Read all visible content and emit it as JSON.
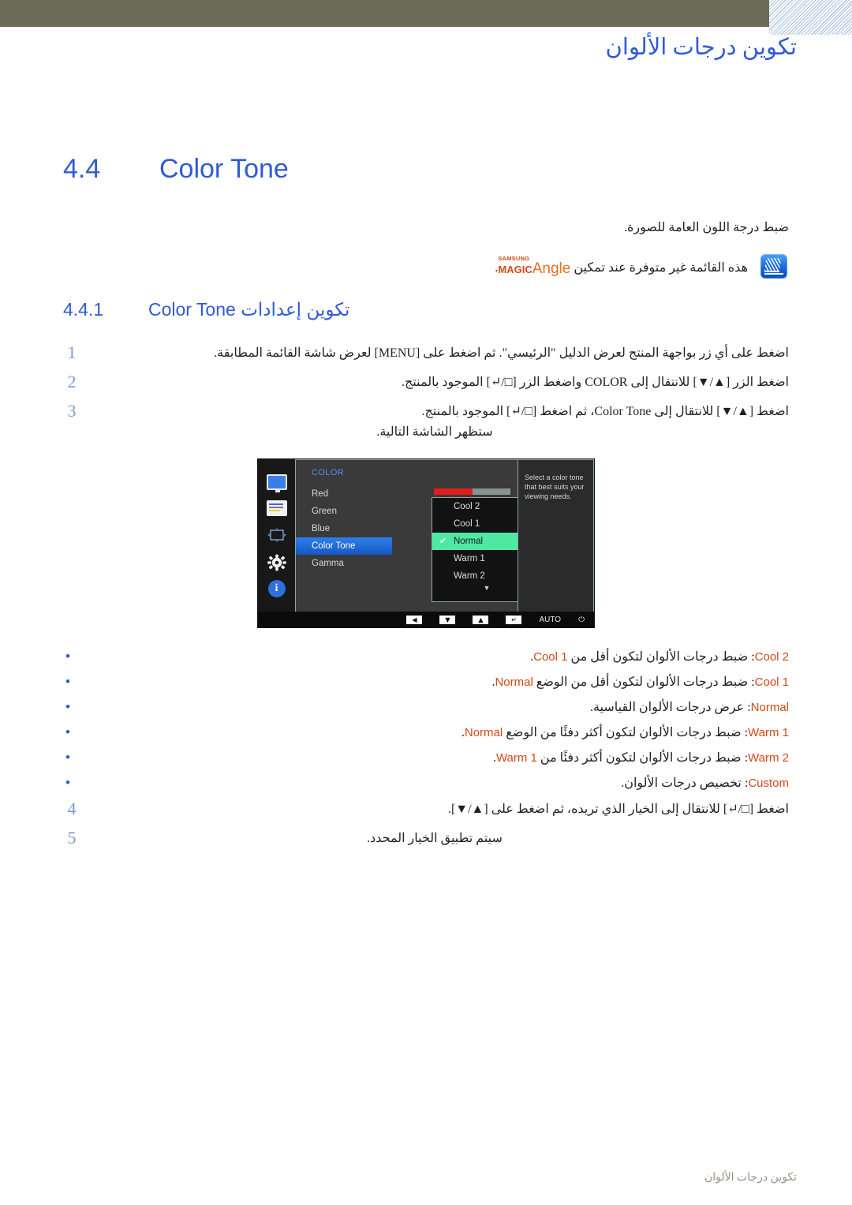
{
  "header": {
    "title": "تكوين درجات الألوان"
  },
  "section": {
    "number": "4.4",
    "title_en": "Color Tone",
    "lead": "ضبط درجة اللون العامة للصورة.",
    "note_pre": "هذه القائمة غير متوفرة عند تمكين",
    "note_post": ".",
    "magic_samsung": "SAMSUNG",
    "magic_magic": "MAGIC",
    "magic_angle": "Angle",
    "magic_icon": "magic-angle-icon"
  },
  "subsection": {
    "number": "4.4.1",
    "title_ar_pre": "تكوين إعدادات",
    "title_en": "Color Tone"
  },
  "steps": [
    {
      "n": "1",
      "text": "اضغط على أي زر بواجهة المنتج لعرض الدليل \"الرئيسي\". ثم اضغط على [MENU] لعرض شاشة القائمة المطابقة.",
      "sub": ""
    },
    {
      "n": "2",
      "text": "اضغط الزر [▲/▼] للانتقال إلى COLOR واضغط الزر [□/↵] الموجود بالمنتج.",
      "sub": ""
    },
    {
      "n": "3",
      "text": "اضغط [▲/▼] للانتقال إلى Color Tone، ثم اضغط [□/↵] الموجود بالمنتج.",
      "sub": "ستظهر الشاشة التالية."
    }
  ],
  "steps_tail": [
    {
      "n": "4",
      "text": "اضغط [□/↵] للانتقال إلى الخيار الذي تريده، ثم اضغط على [▲/▼].",
      "sub": ""
    },
    {
      "n": "5",
      "text": "سيتم تطبيق الخيار المحدد.",
      "sub": ""
    }
  ],
  "osd": {
    "menu_title": "COLOR",
    "sidebar_icons": [
      "monitor-icon",
      "picture-lines-icon",
      "move-arrows-icon",
      "gear-icon",
      "info-icon"
    ],
    "items": [
      {
        "label": "Red",
        "selected": false
      },
      {
        "label": "Green",
        "selected": false
      },
      {
        "label": "Blue",
        "selected": false
      },
      {
        "label": "Color Tone",
        "selected": true
      },
      {
        "label": "Gamma",
        "selected": false
      }
    ],
    "slider_value": "50",
    "slider_percent": 50,
    "slider_fill_color": "#e31c1c",
    "slider_track_color": "#8a9393",
    "dropdown_options": [
      {
        "label": "Cool 2",
        "current": false
      },
      {
        "label": "Cool 1",
        "current": false
      },
      {
        "label": "Normal",
        "current": true
      },
      {
        "label": "Warm 1",
        "current": false
      },
      {
        "label": "Warm 2",
        "current": false
      }
    ],
    "dropdown_more": "▼",
    "checkmark": "✔",
    "help_text": "Select a color tone that best suits your viewing needs.",
    "bottom_buttons": [
      "◀",
      "▼",
      "▲",
      "↵",
      "AUTO",
      "⏻"
    ],
    "highlight_color": "#4ee8a3",
    "selection_color": "#2f7fe8"
  },
  "bullets": [
    {
      "name": "Cool 2",
      "desc": ": ضبط درجات الألوان لتكون أقل من ",
      "ref": "Cool 1",
      "tail": "."
    },
    {
      "name": "Cool 1",
      "desc": ": ضبط درجات الألوان لتكون أقل من الوضع ",
      "ref": "Normal",
      "tail": "."
    },
    {
      "name": "Normal",
      "desc": ": عرض درجات الألوان القياسية.",
      "ref": "",
      "tail": ""
    },
    {
      "name": "Warm 1",
      "desc": ": ضبط درجات الألوان لتكون أكثر دفئًا من الوضع ",
      "ref": "Normal",
      "tail": "."
    },
    {
      "name": "Warm 2",
      "desc": ": ضبط درجات الألوان لتكون أكثر دفئًا من ",
      "ref": "Warm 1",
      "tail": "."
    },
    {
      "name": "Custom",
      "desc": ": تخصيص درجات الألوان.",
      "ref": "",
      "tail": ""
    }
  ],
  "footer": {
    "text": "تكوين درجات الألوان"
  },
  "colors": {
    "header_bar": "#6d6c56",
    "heading_blue": "#2f5bd4",
    "accent_orange": "#cf4a17",
    "footer_text": "#9b8f84"
  }
}
